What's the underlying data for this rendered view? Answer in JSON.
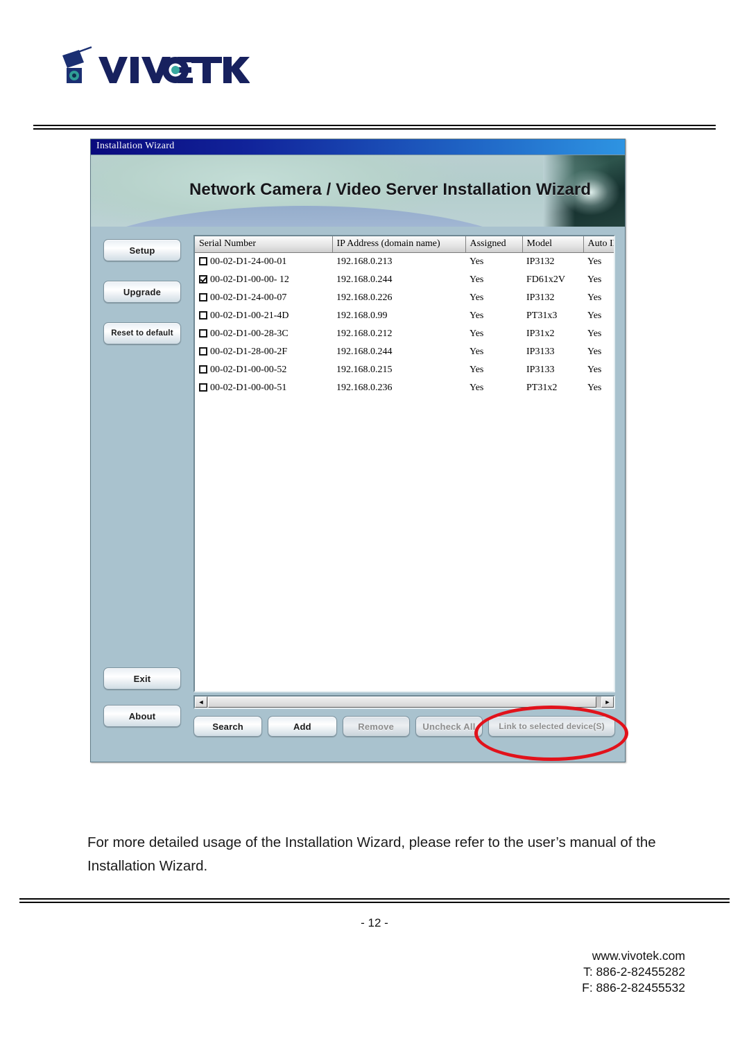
{
  "brand": {
    "logo_text": "VIVOTEK",
    "logo_icon": "camera-icon"
  },
  "window": {
    "titlebar": "Installation Wizard",
    "banner_title": "Network Camera / Video Server Installation Wizard"
  },
  "sidebar": {
    "buttons": [
      {
        "label": "Setup",
        "name": "setup"
      },
      {
        "label": "Upgrade",
        "name": "upgrade"
      },
      {
        "label": "Reset to default",
        "name": "reset-to-default"
      },
      {
        "label": "Exit",
        "name": "exit"
      },
      {
        "label": "About",
        "name": "about"
      }
    ]
  },
  "table": {
    "columns": [
      "Serial Number",
      "IP Address (domain name)",
      "Assigned",
      "Model",
      "Auto IP"
    ],
    "rows": [
      {
        "checked": false,
        "serial": "00-02-D1-24-00-01",
        "ip": "192.168.0.213",
        "assigned": "Yes",
        "model": "IP3132",
        "auto_ip": "Yes"
      },
      {
        "checked": true,
        "serial": "00-02-D1-00-00- 12",
        "ip": "192.168.0.244",
        "assigned": "Yes",
        "model": "FD61x2V",
        "auto_ip": "Yes"
      },
      {
        "checked": false,
        "serial": "00-02-D1-24-00-07",
        "ip": "192.168.0.226",
        "assigned": "Yes",
        "model": "IP3132",
        "auto_ip": "Yes"
      },
      {
        "checked": false,
        "serial": "00-02-D1-00-21-4D",
        "ip": "192.168.0.99",
        "assigned": "Yes",
        "model": "PT31x3",
        "auto_ip": "Yes"
      },
      {
        "checked": false,
        "serial": "00-02-D1-00-28-3C",
        "ip": "192.168.0.212",
        "assigned": "Yes",
        "model": "IP31x2",
        "auto_ip": "Yes"
      },
      {
        "checked": false,
        "serial": "00-02-D1-28-00-2F",
        "ip": "192.168.0.244",
        "assigned": "Yes",
        "model": "IP3133",
        "auto_ip": "Yes"
      },
      {
        "checked": false,
        "serial": "00-02-D1-00-00-52",
        "ip": "192.168.0.215",
        "assigned": "Yes",
        "model": "IP3133",
        "auto_ip": "Yes"
      },
      {
        "checked": false,
        "serial": "00-02-D1-00-00-51",
        "ip": "192.168.0.236",
        "assigned": "Yes",
        "model": "PT31x2",
        "auto_ip": "Yes"
      }
    ]
  },
  "scrollbar": {
    "left_arrow": "◄",
    "right_arrow": "►"
  },
  "actions": {
    "search": "Search",
    "add": "Add",
    "remove": "Remove",
    "uncheck_all": "Uncheck All",
    "link": "Link to selected device(S)"
  },
  "annotation": {
    "shape": "red-ellipse",
    "color": "#e1121b",
    "targets": "link-to-selected-device-button"
  },
  "body_text": "For more detailed usage of the Installation Wizard, please refer to the user’s manual of the Installation Wizard.",
  "footer": {
    "page_number": "- 12 -",
    "website": "www.vivotek.com",
    "tel": "T: 886-2-82455282",
    "fax": "F: 886-2-82455532"
  }
}
